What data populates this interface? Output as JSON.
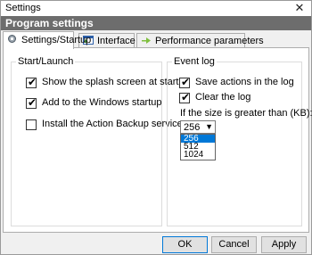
{
  "window": {
    "title": "Settings",
    "close_glyph": "✕"
  },
  "header": {
    "title": "Program settings"
  },
  "tabs": [
    {
      "label": "Settings/Startup",
      "icon": "gear-icon",
      "active": true
    },
    {
      "label": "Interface",
      "icon": "window-icon",
      "active": false
    },
    {
      "label": "Performance parameters",
      "icon": "arrow-icon",
      "active": false
    }
  ],
  "start_group": {
    "label": "Start/Launch",
    "options": [
      {
        "label": "Show the splash screen at startup",
        "checked": true
      },
      {
        "label": "Add to the Windows startup",
        "checked": true
      },
      {
        "label": "Install the Action Backup service",
        "checked": false
      }
    ]
  },
  "event_log": {
    "label": "Event log",
    "options": [
      {
        "label": "Save actions in the log",
        "checked": true
      },
      {
        "label": "Clear the log",
        "checked": true
      }
    ],
    "size_label": "If the size is greater than (KB):",
    "size_value": "256",
    "size_options": [
      "256",
      "512",
      "1024"
    ]
  },
  "buttons": {
    "ok": "OK",
    "cancel": "Cancel",
    "apply": "Apply"
  },
  "check_glyph": "✔",
  "colors": {
    "header_bg": "#6d6d6d",
    "selection": "#0078d7"
  }
}
